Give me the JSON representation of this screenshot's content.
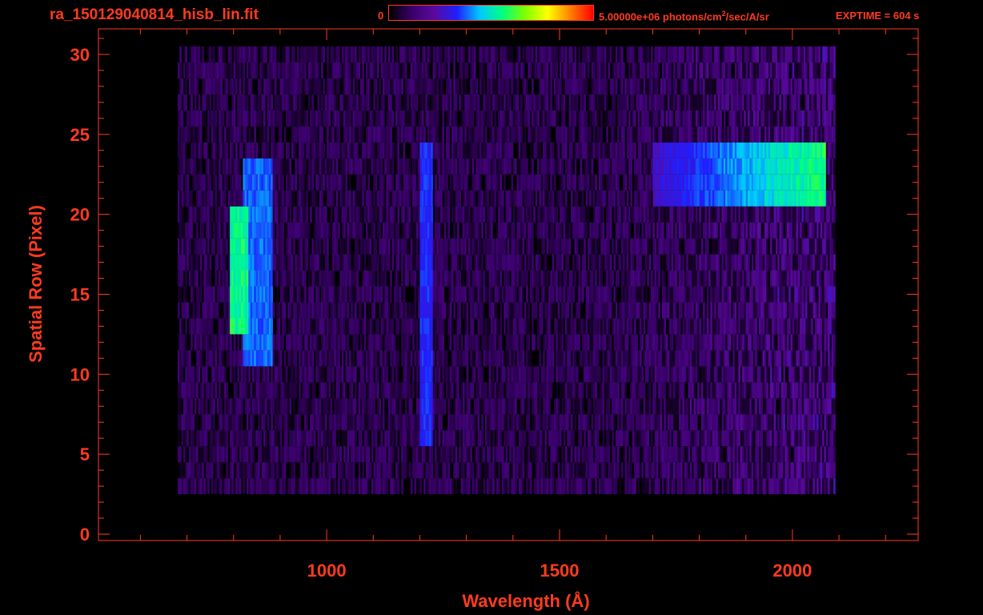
{
  "header": {
    "title": "ra_150129040814_hisb_lin.fit",
    "colorbar_min_label": "0",
    "colorbar_max_label_main": "5.00000e+06 photons/cm",
    "colorbar_max_label_sup": "2",
    "colorbar_max_label_tail": "/sec/A/sr",
    "exptime": "EXPTIME = 604 s"
  },
  "colors": {
    "axis": "#ff3b1f",
    "background": "#000000",
    "colormap": [
      "#000000",
      "#3a006b",
      "#5a0a9e",
      "#1f1fff",
      "#00c8ff",
      "#00ff80",
      "#7fff00",
      "#ffff00",
      "#ff8000",
      "#ff0000"
    ]
  },
  "chart_data": {
    "type": "heatmap",
    "title": "ra_150129040814_hisb_lin.fit",
    "xlabel": "Wavelength (Å)",
    "ylabel": "Spatial Row (Pixel)",
    "xlim": [
      510,
      2270
    ],
    "ylim": [
      -0.4,
      31.6
    ],
    "xticks": [
      1000,
      1500,
      2000
    ],
    "yticks": [
      0,
      5,
      10,
      15,
      20,
      25,
      30
    ],
    "colorbar_range": [
      0,
      5000000
    ],
    "colorbar_units": "photons/cm²/sec/A/sr",
    "data_extent_x": [
      680,
      2090
    ],
    "data_extent_y": [
      3,
      30
    ],
    "features": [
      {
        "label": "strong emission band",
        "x_range": [
          1700,
          2070
        ],
        "y_range": [
          21,
          24
        ],
        "intensity_fraction": 0.6
      },
      {
        "label": "bright arc",
        "x_range": [
          790,
          830
        ],
        "y_range": [
          13,
          20
        ],
        "intensity_fraction": 0.58
      },
      {
        "label": "second arc",
        "x_range": [
          820,
          880
        ],
        "y_range": [
          11,
          23
        ],
        "intensity_fraction": 0.4
      },
      {
        "label": "vertical line",
        "x_range": [
          1200,
          1225
        ],
        "y_range": [
          6,
          24
        ],
        "intensity_fraction": 0.35
      }
    ]
  }
}
